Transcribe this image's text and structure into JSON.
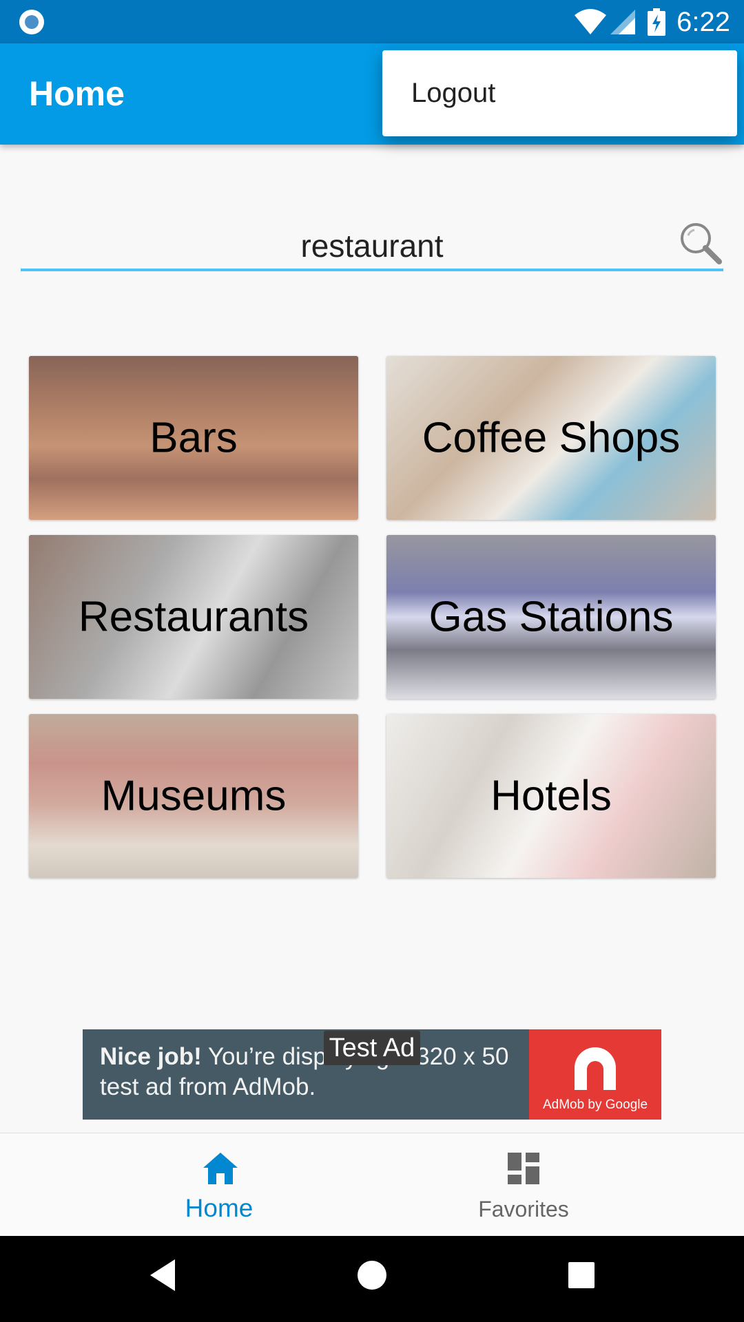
{
  "status_bar": {
    "time": "6:22",
    "icons": [
      "notification-icon",
      "wifi-icon",
      "cell-signal-icon",
      "battery-charging-icon"
    ]
  },
  "app_bar": {
    "title": "Home",
    "accent": "#039be5"
  },
  "overflow_menu": {
    "items": [
      {
        "label": "Logout"
      }
    ]
  },
  "search": {
    "value": "restaurant",
    "icon": "search-icon",
    "underline_color": "#4fc3f7"
  },
  "categories": [
    {
      "label": "Bars"
    },
    {
      "label": "Coffee Shops"
    },
    {
      "label": "Restaurants"
    },
    {
      "label": "Gas Stations"
    },
    {
      "label": "Museums"
    },
    {
      "label": "Hotels"
    }
  ],
  "ad": {
    "badge": "Test Ad",
    "headline": "Nice job!",
    "body": "You’re displaying a 320 x 50 test ad from AdMob.",
    "brand": "AdMob by Google",
    "brand_color": "#e53935"
  },
  "bottom_nav": {
    "items": [
      {
        "label": "Home",
        "icon": "home-icon",
        "active": true
      },
      {
        "label": "Favorites",
        "icon": "dashboard-icon",
        "active": false
      }
    ],
    "active_color": "#0288d1"
  },
  "system_nav": {
    "icons": [
      "back-icon",
      "home-circle-icon",
      "recents-icon"
    ]
  }
}
